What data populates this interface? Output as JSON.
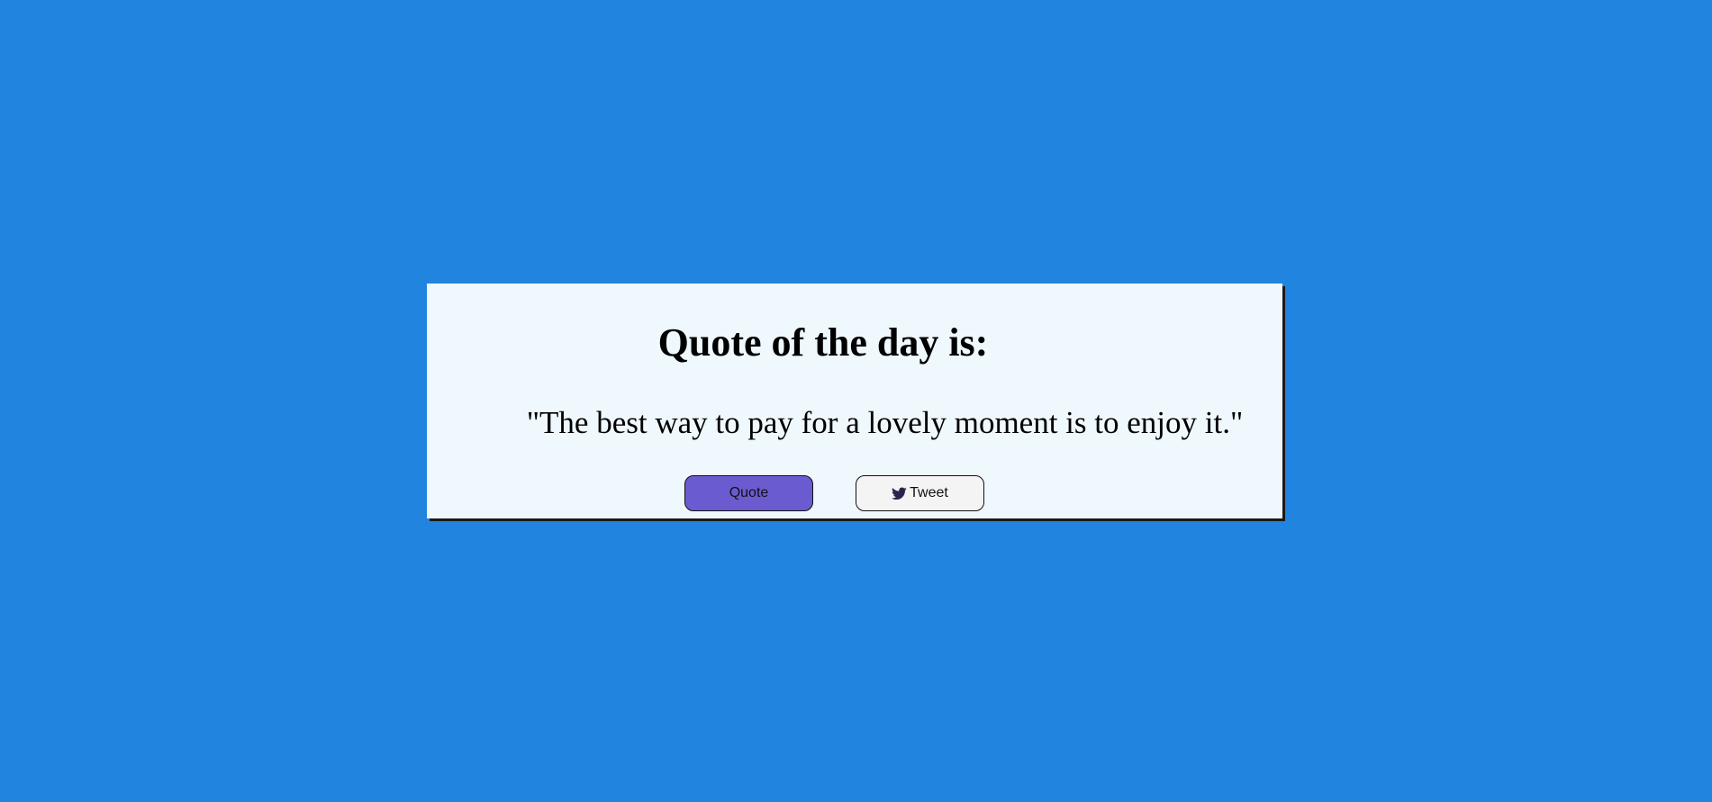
{
  "card": {
    "title": "Quote of the day is:",
    "quote": "\"The best way to pay for a lovely moment is to enjoy it.\""
  },
  "buttons": {
    "quote_label": "Quote",
    "tweet_label": "Tweet",
    "tweet_icon": "twitter-bird-icon"
  },
  "colors": {
    "background": "#2184df",
    "card_background": "#eff8fd",
    "quote_button": "#6b5bd0",
    "tweet_button": "#f4f4f4"
  }
}
